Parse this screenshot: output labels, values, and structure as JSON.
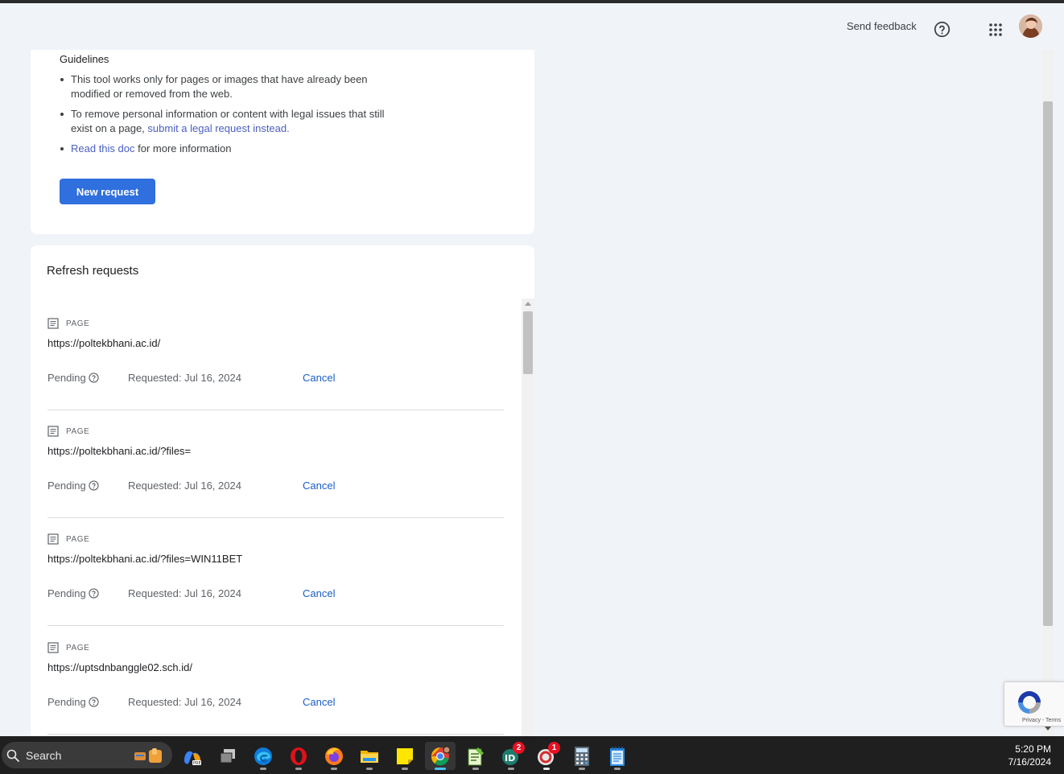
{
  "header": {
    "send_feedback": "Send feedback",
    "help_icon": "help-circle-icon",
    "apps_icon": "apps-grid-icon"
  },
  "guidelines": {
    "title": "Guidelines",
    "item1": "This tool works only for pages or images that have already been modified or removed from the web.",
    "item2_prefix": "To remove personal information or content with legal issues that still exist on a page, ",
    "item2_link": "submit a legal request instead.",
    "item3_link": "Read this doc",
    "item3_suffix": " for more information",
    "new_request": "New request"
  },
  "refresh": {
    "title": "Refresh requests",
    "requests": [
      {
        "type": "PAGE",
        "url": "https://poltekbhani.ac.id/",
        "status": "Pending",
        "requested": "Requested: Jul 16, 2024",
        "action": "Cancel"
      },
      {
        "type": "PAGE",
        "url": "https://poltekbhani.ac.id/?files=",
        "status": "Pending",
        "requested": "Requested: Jul 16, 2024",
        "action": "Cancel"
      },
      {
        "type": "PAGE",
        "url": "https://poltekbhani.ac.id/?files=WIN11BET",
        "status": "Pending",
        "requested": "Requested: Jul 16, 2024",
        "action": "Cancel"
      },
      {
        "type": "PAGE",
        "url": "https://uptsdnbanggle02.sch.id/",
        "status": "Pending",
        "requested": "Requested: Jul 16, 2024",
        "action": "Cancel"
      }
    ]
  },
  "recaptcha": {
    "terms": "Privacy - Terms"
  },
  "taskbar": {
    "search_label": "Search",
    "apps": [
      {
        "name": "copilot-icon"
      },
      {
        "name": "task-view-icon"
      },
      {
        "name": "edge-icon"
      },
      {
        "name": "opera-icon"
      },
      {
        "name": "firefox-icon"
      },
      {
        "name": "file-explorer-icon"
      },
      {
        "name": "sticky-notes-icon"
      },
      {
        "name": "chrome-icon"
      },
      {
        "name": "notepad-plus-icon"
      },
      {
        "name": "app-badge-2-icon",
        "badge": "2"
      },
      {
        "name": "app-badge-1-icon",
        "badge": "1"
      },
      {
        "name": "calculator-icon"
      },
      {
        "name": "notepad-icon"
      }
    ],
    "time": "5:20 PM",
    "date": "7/16/2024"
  },
  "colors": {
    "background": "#f0f4f8",
    "primary_button": "#2f6fde",
    "link": "#1a5dc8",
    "taskbar": "#1f1f1f"
  }
}
